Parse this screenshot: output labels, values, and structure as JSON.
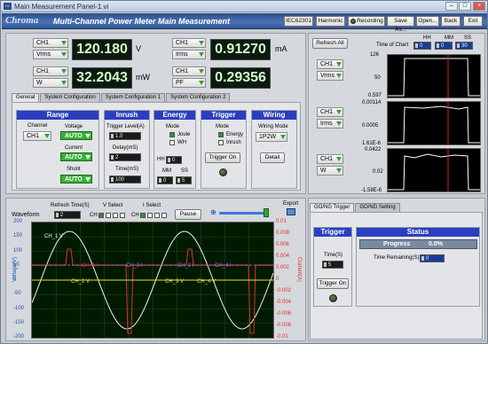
{
  "window": {
    "title": "Main Measurement Panel-1.vi"
  },
  "header": {
    "logo": "Chroma",
    "title": "Multi-Channel Power Meter Main Measurement",
    "buttons": {
      "iec": "IEC62301",
      "harmonic": "Harmonic",
      "recording": "Recording",
      "save_as": "Save As...",
      "open": "Open...",
      "back": "Back",
      "exit": "Exit"
    }
  },
  "meters": [
    {
      "channel": "CH1",
      "param": "Vrms",
      "value": "120.180",
      "unit": "V"
    },
    {
      "channel": "CH1",
      "param": "Irms",
      "value": "0.91270",
      "unit": "mA"
    },
    {
      "channel": "CH1",
      "param": "W",
      "value": "32.2043",
      "unit": "mW"
    },
    {
      "channel": "CH1",
      "param": "PF",
      "value": "0.29356",
      "unit": ""
    }
  ],
  "config_tabs": [
    "General",
    "System Configuration",
    "System Configuration 1",
    "System Configuration 2"
  ],
  "range": {
    "title": "Range",
    "channel_label": "Channel",
    "channel": "CH1",
    "voltage_label": "Voltage",
    "voltage": "AUTO",
    "current_label": "Current",
    "current": "AUTO",
    "shunt_label": "Shunt",
    "shunt": "AUTO"
  },
  "inrush": {
    "title": "Inrush",
    "trigger_level_label": "Trigger Level(A)",
    "trigger_level": "1.0",
    "delay_label": "Delay(mS)",
    "delay": "2",
    "time_label": "Time(mS)",
    "time": "100"
  },
  "energy": {
    "title": "Energy",
    "mode_label": "Mode",
    "joule": "Joule",
    "wh": "WH",
    "hh_label": "HH",
    "hh": "0",
    "mm_label": "MM",
    "mm": "0",
    "ss_label": "SS",
    "ss": "5"
  },
  "trigger": {
    "title": "Trigger",
    "mode_label": "Mode",
    "energy": "Energy",
    "inrush": "Inrush",
    "button": "Trigger On"
  },
  "wiring": {
    "title": "Wiring",
    "mode_label": "Wiring Mode",
    "mode": "1P2W",
    "detail": "Detail"
  },
  "chart_panel": {
    "refresh_all": "Refresh All",
    "time_of_chart_label": "Time of Chart",
    "hh_label": "HH",
    "mm_label": "MM",
    "ss_label": "SS",
    "hh": "0",
    "mm": "0",
    "ss": "30",
    "charts": [
      {
        "channel": "CH1",
        "param": "Vrms",
        "ymax": "126",
        "ymid": "50",
        "ymin": "0.597"
      },
      {
        "channel": "CH1",
        "param": "Irms",
        "ymax": "0.00114",
        "ymid": "0.0005",
        "ymin": "1.61E-6"
      },
      {
        "channel": "CH1",
        "param": "W",
        "ymax": "0.0422",
        "ymid": "0.02",
        "ymin": "-1.58E-6"
      }
    ]
  },
  "waveform": {
    "label": "Waveform",
    "refresh_label": "Refresh Time(S)",
    "refresh": "2",
    "v_select_label": "V Select",
    "i_select_label": "I Select",
    "ch_label": "CH",
    "pause": "Pause",
    "export": "Export",
    "yleft_label": "Voltage(V)",
    "yright_label": "Current(A)",
    "yleft_ticks": [
      "200",
      "150",
      "100",
      "50",
      "0",
      "-50",
      "-100",
      "-150",
      "-200"
    ],
    "yright_ticks": [
      "0.01",
      "0.008",
      "0.006",
      "0.004",
      "0.002",
      "0",
      "-0.002",
      "-0.004",
      "-0.006",
      "-0.008",
      "-0.01"
    ],
    "trace_labels": [
      "CH_1 V",
      "CH_2 V",
      "CH_3 V",
      "CH_4 V",
      "CH_1 I",
      "CH_2 I",
      "CH_3 I",
      "CH_4 I"
    ]
  },
  "gonogo": {
    "tabs": [
      "GO/NG Trigger",
      "GO/NG Setting"
    ],
    "trigger_title": "Trigger",
    "time_label": "Time(S)",
    "time": "5",
    "trigger_button": "Trigger On",
    "status_title": "Status",
    "progress_label": "Progress",
    "progress_value": "0.0%",
    "progress_fraction": 0,
    "time_remaining_label": "Time Remaining(S)",
    "time_remaining": "0"
  },
  "colors": {
    "header_blue": "#2c4f8c",
    "group_blue": "#2a3fbf",
    "meter_bg": "#0c1a0c",
    "meter_text": "#d0ffd0",
    "voltage_trace": "#f0f0f0",
    "current_trace": "#e03030",
    "ch2_trace": "#e0e040",
    "ch3_trace": "#c060e0"
  }
}
